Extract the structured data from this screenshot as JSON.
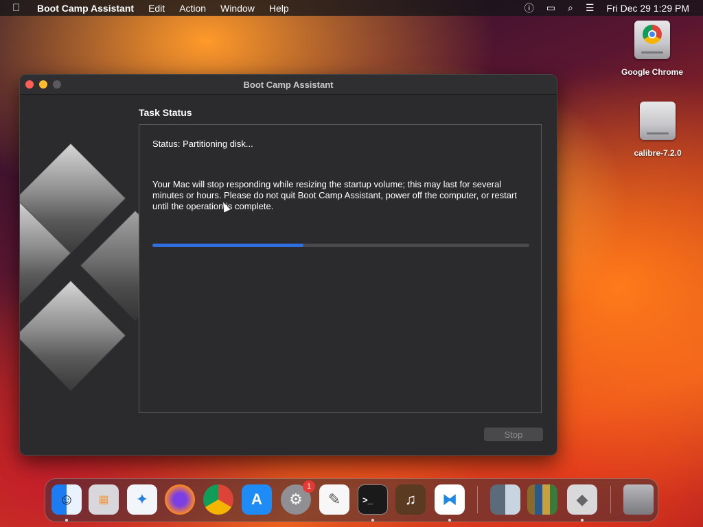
{
  "menubar": {
    "app_name": "Boot Camp Assistant",
    "menus": [
      "Edit",
      "Action",
      "Window",
      "Help"
    ],
    "clock": "Fri Dec 29  1:29 PM"
  },
  "desktop": {
    "icons": [
      {
        "label": "Google Chrome"
      },
      {
        "label": "calibre-7.2.0"
      }
    ]
  },
  "window": {
    "title": "Boot Camp Assistant",
    "heading": "Task Status",
    "status": "Status: Partitioning disk...",
    "message": "Your Mac will stop responding while resizing the startup volume; this may last for several minutes or hours. Please do not quit Boot Camp Assistant, power off the computer, or restart until the operation is complete.",
    "progress_percent": 40,
    "stop_label": "Stop"
  },
  "dock": {
    "system_settings_badge": "1",
    "apps": [
      "finder-icon",
      "launchpad-icon",
      "safari-icon",
      "firefox-icon",
      "chrome-icon",
      "app-store-icon",
      "system-settings-icon",
      "textedit-icon",
      "terminal-icon",
      "garageband-icon",
      "vscode-icon",
      "finder-icon",
      "calibre-icon",
      "boot-camp-icon",
      "trash-icon"
    ]
  },
  "colors": {
    "accent": "#2f6fe0",
    "close": "#ff5f57",
    "minimize": "#febc2e"
  }
}
